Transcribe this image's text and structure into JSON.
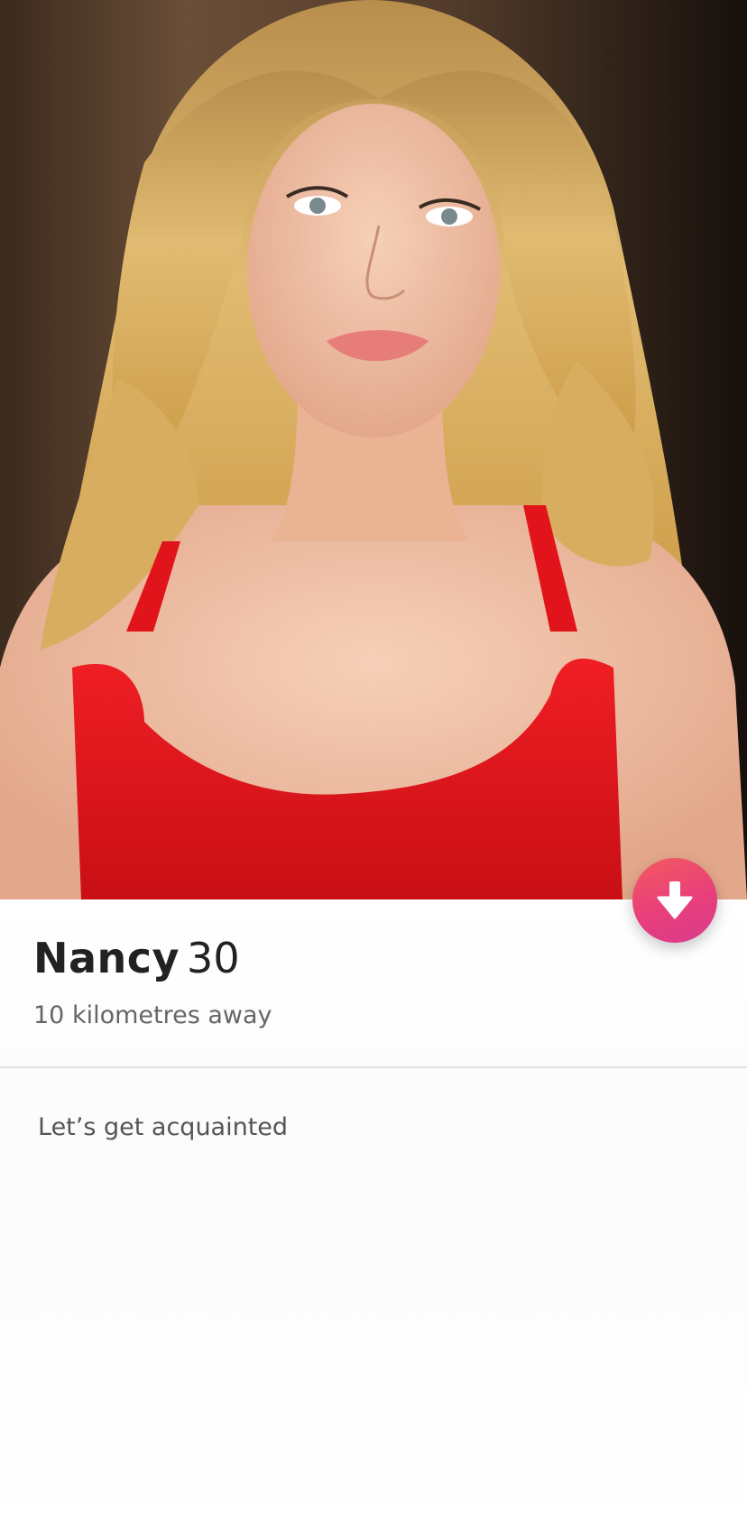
{
  "profile": {
    "name": "Nancy",
    "age": "30",
    "distance": "10 kilometres away",
    "bio": "Let’s get acquainted"
  },
  "photo": {
    "description_icon": "profile-photo"
  },
  "actions": {
    "collapse_icon": "arrow-down-icon"
  },
  "colors": {
    "accent_start": "#f45a5e",
    "accent_end": "#d93a8c",
    "dress": "#e0141b",
    "hair": "#d9b265",
    "background": "#5a4130"
  }
}
